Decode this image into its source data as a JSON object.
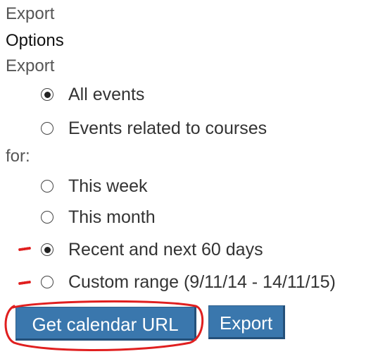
{
  "header": {
    "top_label": "Export",
    "section_title": "Options"
  },
  "events_group": {
    "label": "Export",
    "options": [
      {
        "label": "All events",
        "checked": true
      },
      {
        "label": "Events related to courses",
        "checked": false
      }
    ]
  },
  "period_group": {
    "label": "for:",
    "options": [
      {
        "label": "This week",
        "checked": false
      },
      {
        "label": "This month",
        "checked": false
      },
      {
        "label": "Recent and next 60 days",
        "checked": true
      },
      {
        "label": "Custom range (9/11/14 - 14/11/15)",
        "checked": false
      }
    ]
  },
  "actions": {
    "get_url_label": "Get calendar URL",
    "export_label": "Export"
  },
  "colors": {
    "button_bg": "#3a77ad",
    "annotation": "#e01f1f"
  }
}
